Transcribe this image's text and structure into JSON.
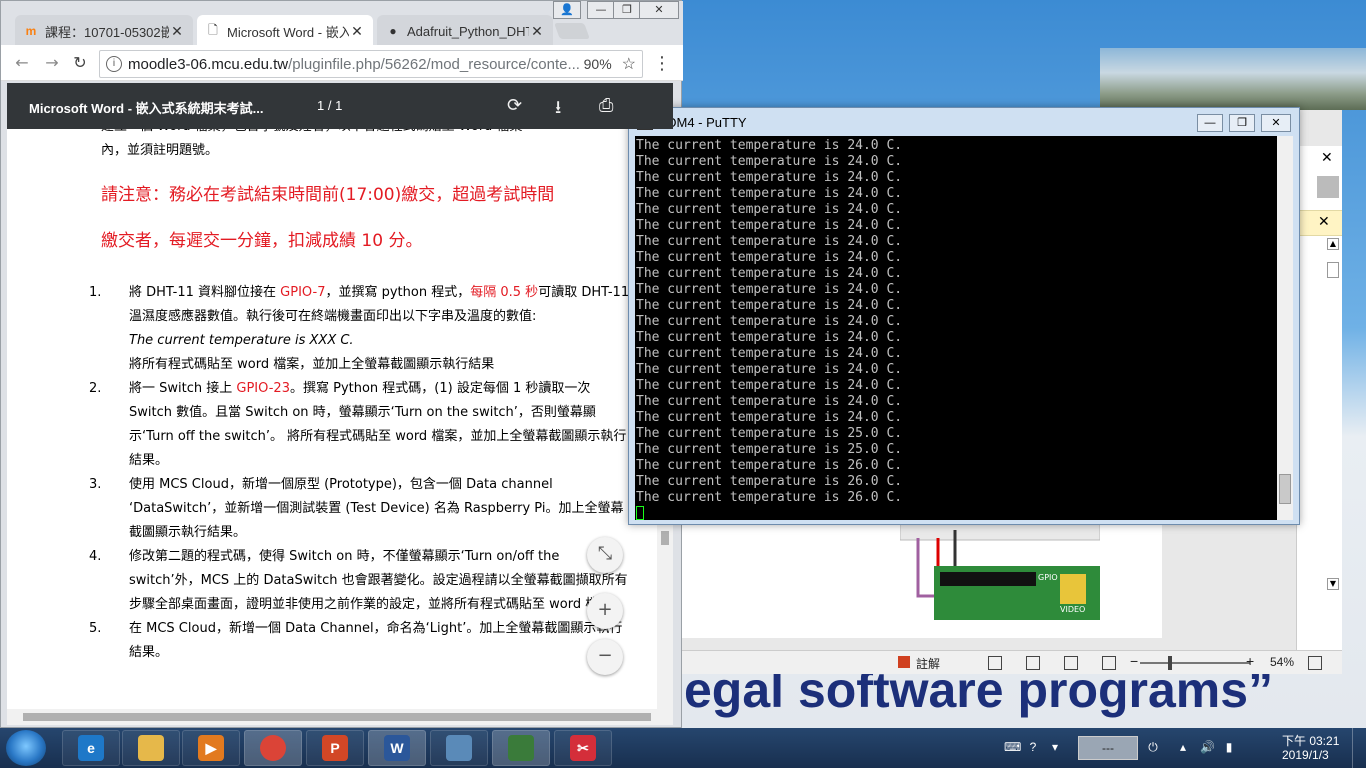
{
  "chrome": {
    "tabs": [
      {
        "title": "課程：10701-05302嵌",
        "icon": "moodle-icon"
      },
      {
        "title": "Microsoft Word - 嵌入",
        "icon": "document-icon"
      },
      {
        "title": "Adafruit_Python_DHT",
        "icon": "github-icon"
      }
    ],
    "url_host": "moodle3-06.mcu.edu.tw",
    "url_path": "/pluginfile.php/56262/mod_resource/conte...",
    "zoom": "90%"
  },
  "pdf": {
    "title": "Microsoft Word - 嵌入式系統期末考試...",
    "pages": "1  /  1",
    "intro_line1": "建立一個 Word 檔案，包含學號及姓名，以下各題程式碼貼至 Word 檔案",
    "intro_line2": "內，並須註明題號。",
    "warn_line1": "請注意：務必在考試結束時間前(17:00)繳交，超過考試時間",
    "warn_line2": "繳交者，每遲交一分鐘，扣減成績  10  分。",
    "q1": {
      "num": "1.",
      "a": "將 DHT-11 資料腳位接在 ",
      "b": "GPIO-7",
      "c": "，並撰寫 python 程式，",
      "d": "每隔 0.5 秒",
      "e": "可讀取 DHT-11 溫濕度感應器數值。執行後可在終端機畫面印出以下字串及溫度的數值:",
      "sample": "The current temperature is XXX C.",
      "f": "將所有程式碼貼至 word 檔案，並加上全螢幕截圖顯示執行結果"
    },
    "q2": {
      "num": "2.",
      "a": "將一 Switch 接上 ",
      "b": "GPIO-23",
      "c": "。撰寫 Python 程式碼，(1) 設定每個 1 秒讀取一次 Switch 數值。且當 Switch on 時，螢幕顯示‘Turn on the switch’，否則螢幕顯示‘Turn off the switch’。 將所有程式碼貼至 word 檔案，並加上全螢幕截圖顯示執行結果。"
    },
    "q3": {
      "num": "3.",
      "text": "使用 MCS Cloud，新增一個原型 (Prototype)，包含一個 Data channel ‘DataSwitch’，並新增一個測試裝置 (Test Device) 名為 Raspberry Pi。加上全螢幕截圖顯示執行結果。"
    },
    "q4": {
      "num": "4.",
      "text": "修改第二題的程式碼，使得 Switch on 時，不僅螢幕顯示‘Turn on/off the switch’外，MCS 上的 DataSwitch 也會跟著變化。設定過程請以全螢幕截圖擷取所有步驟全部桌面畫面，證明並非使用之前作業的設定，並將所有程式碼貼至 word 檔案。"
    },
    "q5": {
      "num": "5.",
      "text": "在 MCS Cloud，新增一個 Data Channel，命名為‘Light’。加上全螢幕截圖顯示執行結果。"
    }
  },
  "putty": {
    "title": "COM4 - PuTTY",
    "lines": [
      "The current temperature is 24.0 C.",
      "The current temperature is 24.0 C.",
      "The current temperature is 24.0 C.",
      "The current temperature is 24.0 C.",
      "The current temperature is 24.0 C.",
      "The current temperature is 24.0 C.",
      "The current temperature is 24.0 C.",
      "The current temperature is 24.0 C.",
      "The current temperature is 24.0 C.",
      "The current temperature is 24.0 C.",
      "The current temperature is 24.0 C.",
      "The current temperature is 24.0 C.",
      "The current temperature is 24.0 C.",
      "The current temperature is 24.0 C.",
      "The current temperature is 24.0 C.",
      "The current temperature is 24.0 C.",
      "The current temperature is 24.0 C.",
      "The current temperature is 24.0 C.",
      "The current temperature is 25.0 C.",
      "The current temperature is 25.0 C.",
      "The current temperature is 26.0 C.",
      "The current temperature is 26.0 C.",
      "The current temperature is 26.0 C."
    ]
  },
  "word": {
    "notes": "註解",
    "zoom": "54%",
    "gpio_label": "GPIO",
    "video_label": "VIDEO"
  },
  "desktop": {
    "slide_text": "egal software programs”"
  },
  "taskbar": {
    "time": "下午 03:21",
    "date": "2019/1/3",
    "input_indicator": "---"
  },
  "colors": {
    "warning_red": "#e31b23",
    "pdf_bar": "#323639",
    "terminal_bg": "#000000",
    "terminal_text": "#c0c0c0"
  }
}
